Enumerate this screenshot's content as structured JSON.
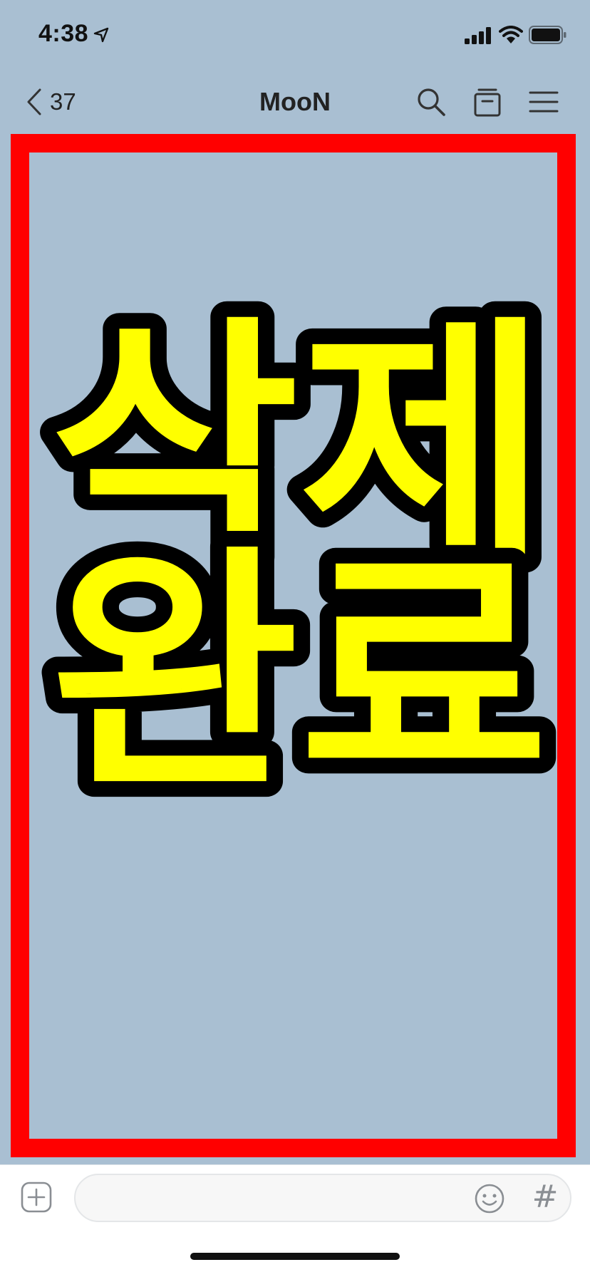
{
  "status_bar": {
    "time": "4:38",
    "icons": [
      "location-arrow-icon",
      "cellular-signal-icon",
      "wifi-icon",
      "battery-icon"
    ]
  },
  "nav": {
    "back_count": "37",
    "title": "MooN",
    "icons": [
      "chevron-left-icon",
      "search-icon",
      "archive-box-icon",
      "menu-icon"
    ]
  },
  "chat": {
    "image_text_line1": "삭제",
    "image_text_line2": "완료",
    "colors": {
      "background": "#a9bfd2",
      "frame": "#ff0000",
      "text_fill": "#ffff00",
      "text_outline": "#000000"
    }
  },
  "input_bar": {
    "placeholder": "",
    "hash_label": "#",
    "icons": [
      "plus-square-icon",
      "emoji-smile-icon",
      "hashtag-icon"
    ]
  }
}
